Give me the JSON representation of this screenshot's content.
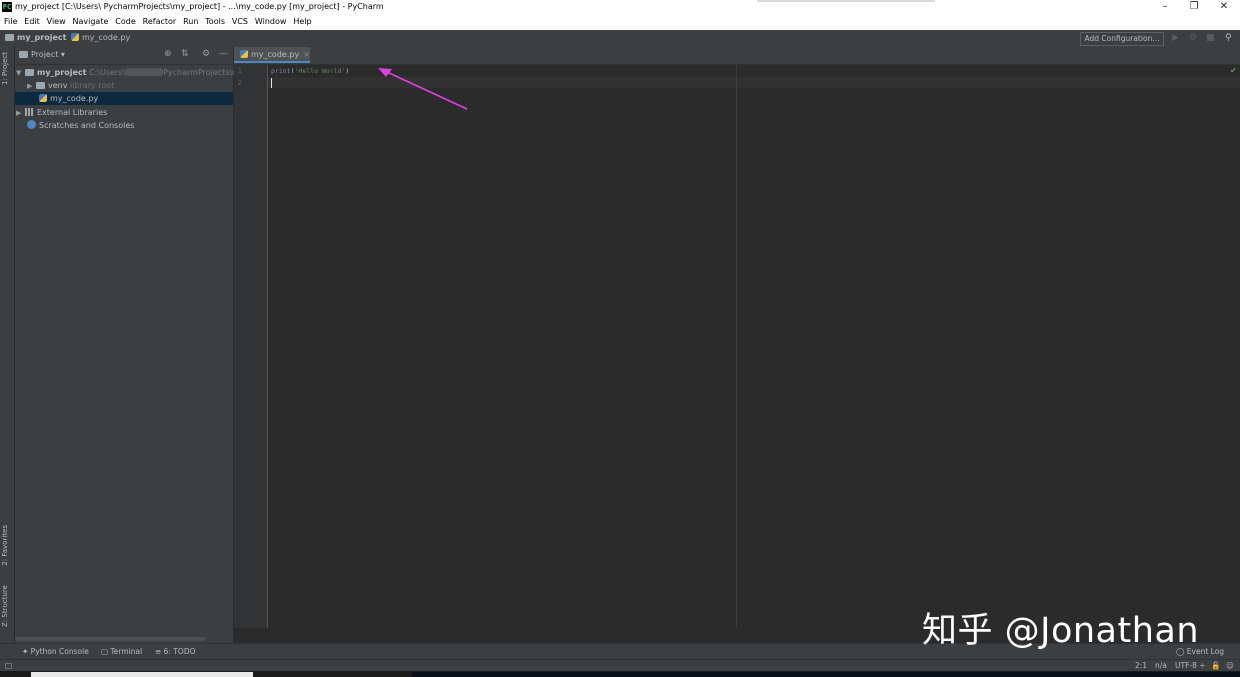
{
  "titlebar": {
    "app_icon": "PC",
    "title": "my_project [C:\\Users\\ PycharmProjects\\my_project] - ...\\my_code.py [my_project] - PyCharm",
    "minimize_icon": "minimize-icon",
    "restore_icon": "restore-icon",
    "close_icon": "close-icon"
  },
  "menu": [
    "File",
    "Edit",
    "View",
    "Navigate",
    "Code",
    "Refactor",
    "Run",
    "Tools",
    "VCS",
    "Window",
    "Help"
  ],
  "navbar": {
    "project": "my_project",
    "file": "my_code.py",
    "add_configuration": "Add Configuration...",
    "icons": [
      "run-icon",
      "debug-icon",
      "stop-icon",
      "search-icon"
    ]
  },
  "left_strip": {
    "project_tab": "1: Project",
    "favorites_tab": "2: Favorites",
    "structure_tab": "Z: Structure"
  },
  "project_panel": {
    "title": "Project",
    "tree": {
      "root": "my_project",
      "root_path_prefix": "C:\\Users\\",
      "root_path_suffix": "PycharmProjects\\my",
      "venv": "venv",
      "venv_note": "library root",
      "file": "my_code.py",
      "external": "External Libraries",
      "scratches": "Scratches and Consoles"
    }
  },
  "editor": {
    "tab_label": "my_code.py",
    "tab_close": "×",
    "lines": [
      "1",
      "2"
    ],
    "code_keyword": "print",
    "code_open": "(",
    "code_string": "'Hello World'",
    "code_close": ")",
    "inspection_ok": "✔"
  },
  "bottom_tools": {
    "python_console": "Python Console",
    "terminal": "Terminal",
    "todo": "6: TODO",
    "event_log": "Event Log"
  },
  "status": {
    "position": "2:1",
    "na": "n/a",
    "encoding": "UTF-8 ÷"
  },
  "watermark": "知乎 @Jonathan",
  "colors": {
    "accent": "#4a88c7",
    "annotation_arrow": "#e040e0"
  }
}
